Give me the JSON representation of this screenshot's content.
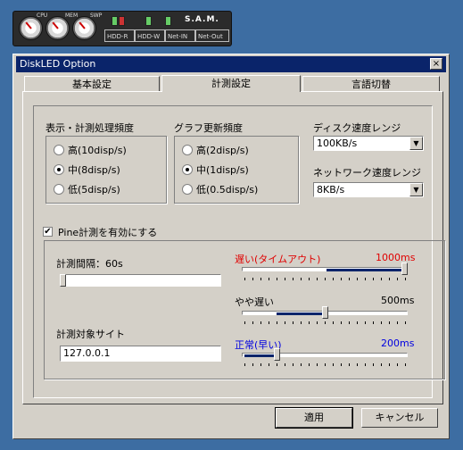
{
  "widget": {
    "gauges": [
      "CPU",
      "MEM",
      "SWP"
    ],
    "boxes": [
      "HDD-R",
      "HDD-W",
      "Net-IN",
      "Net-Out"
    ],
    "brand": "S.A.M."
  },
  "window": {
    "title": "DiskLED Option",
    "close_glyph": "×"
  },
  "tabs": [
    {
      "label": "基本設定",
      "active": false
    },
    {
      "label": "計測設定",
      "active": true
    },
    {
      "label": "言語切替",
      "active": false
    }
  ],
  "display_freq": {
    "label": "表示・計測処理頻度",
    "options": [
      "高(10disp/s)",
      "中(8disp/s)",
      "低(5disp/s)"
    ],
    "selected": 1
  },
  "graph_freq": {
    "label": "グラフ更新頻度",
    "options": [
      "高(2disp/s)",
      "中(1disp/s)",
      "低(0.5disp/s)"
    ],
    "selected": 1
  },
  "disk_speed": {
    "label": "ディスク速度レンジ",
    "value": "100KB/s"
  },
  "net_speed": {
    "label": "ネットワーク速度レンジ",
    "value": "8KB/s"
  },
  "ping": {
    "checkbox_label": "Pine計測を有効にする",
    "checked": true,
    "interval_label": "計測間隔：60s",
    "interval_level": 0.0,
    "target_label": "計測対象サイト",
    "target_value": "127.0.0.1",
    "slow": {
      "label": "遅い(タイムアウト)",
      "value": "1000ms",
      "level": 1.0,
      "color": "#e00000"
    },
    "medium": {
      "label": "やや遅い",
      "value": "500ms",
      "level": 0.5,
      "color": "#000000"
    },
    "normal": {
      "label": "正常(早い)",
      "value": "200ms",
      "level": 0.2,
      "color": "#0000e0"
    }
  },
  "buttons": {
    "apply": "適用",
    "cancel": "キャンセル"
  },
  "colors": {
    "titlebar": "#0a246a",
    "desktop": "#3d6da2",
    "face": "#d4d0c8"
  }
}
